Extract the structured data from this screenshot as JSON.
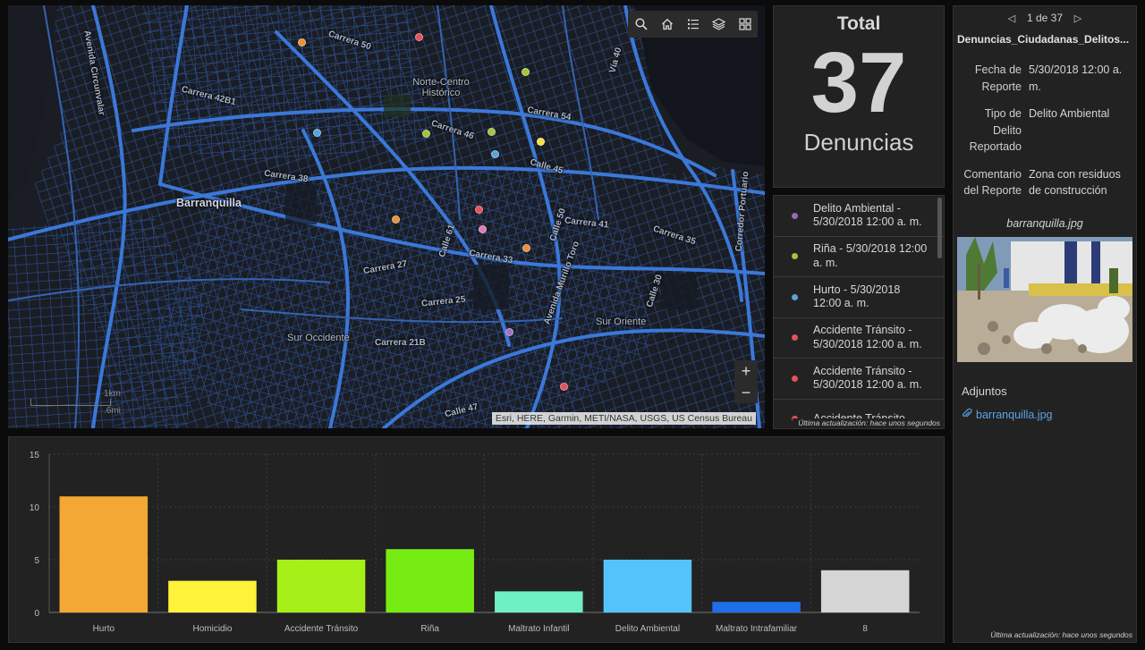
{
  "map": {
    "labels": {
      "city": "Barranquilla",
      "district_ne": "Norte-Centro\nHistórico",
      "district_sw": "Sur Occidente",
      "district_se": "Sur Oriente",
      "carrera_50": "Carrera 50",
      "carrera_46": "Carrera 46",
      "carrera_38": "Carrera 38",
      "carrera_27": "Carrera 27",
      "carrera_21b": "Carrera 21B",
      "carrera_42b1": "Carrera 42B1",
      "calle_47": "Calle 47",
      "avenida_circunvalar": "Avenida Circunvalar",
      "avenida_murillo": "Avenida Murillo Toro",
      "carrera_25": "Carrera 25",
      "carrera_33": "Carrera 33",
      "carrera_54": "Carrera 54",
      "carrera_41": "Carrera 41",
      "carrera_35": "Carrera 35",
      "calle_30": "Calle 30",
      "calle_45": "Calle 45",
      "calle_61": "Calle 61",
      "calle_50": "Calle 50",
      "via_40": "Vía 40",
      "corredor_portuario": "Corredor Portuario"
    },
    "scale_km": "1km",
    "scale_mi": ".6mi",
    "attribution": "Esri, HERE, Garmin, METI/NASA, USGS, US Census Bureau",
    "points_colors": {
      "orange": "#e8913a",
      "red": "#e2535a",
      "green": "#a3c43c",
      "blue": "#5aa3d8",
      "yellow": "#f0e04a",
      "pink": "#e07bb0",
      "purple": "#a272c2"
    }
  },
  "toolbar": {
    "search": "search-icon",
    "home": "home-icon",
    "legend": "legend-icon",
    "layers": "layers-icon",
    "basemap": "basemap-gallery-icon"
  },
  "indicator": {
    "title": "Total",
    "value": "37",
    "unit": "Denuncias"
  },
  "list": {
    "items": [
      {
        "text": "Delito Ambiental - 5/30/2018 12:00 a. m.",
        "color": "#9a6ab8"
      },
      {
        "text": "Riña - 5/30/2018 12:00 a. m.",
        "color": "#a5c23e"
      },
      {
        "text": "Hurto - 5/30/2018 12:00 a. m.",
        "color": "#5aa3d8"
      },
      {
        "text": "Accidente Tránsito - 5/30/2018 12:00 a. m.",
        "color": "#e2535a"
      },
      {
        "text": "Accidente Tránsito - 5/30/2018 12:00 a. m.",
        "color": "#e2535a"
      },
      {
        "text": "Accidente Tránsito -",
        "color": "#e2535a"
      }
    ],
    "updated": "Última actualización: hace unos segundos"
  },
  "details": {
    "pager": "1 de 37",
    "title": "Denuncias_Ciudadanas_Delitos...",
    "fields": [
      {
        "k": "Fecha de Reporte",
        "v": "5/30/2018 12:00 a. m."
      },
      {
        "k": "Tipo de Delito Reportado",
        "v": "Delito Ambiental"
      },
      {
        "k": "Comentario del Reporte",
        "v": "Zona con residuos de construcción"
      }
    ],
    "caption": "barranquilla.jpg",
    "attachments_heading": "Adjuntos",
    "attachment": "barranquilla.jpg",
    "updated": "Última actualización: hace unos segundos"
  },
  "chart_data": {
    "type": "bar",
    "categories": [
      "Hurto",
      "Homicidio",
      "Accidente Tránsito",
      "Riña",
      "Maltrato Infantil",
      "Delito Ambiental",
      "Maltrato Intrafamiliar",
      "8"
    ],
    "values": [
      11,
      3,
      5,
      6,
      2,
      5,
      1,
      4
    ],
    "colors": [
      "#f3a833",
      "#fff23a",
      "#a7ef18",
      "#76ec12",
      "#6ff0c4",
      "#54c3fb",
      "#1f6fe8",
      "#d5d5d5"
    ],
    "ylim": [
      0,
      15
    ],
    "yticks": [
      0,
      5,
      10,
      15
    ],
    "grid": true
  }
}
